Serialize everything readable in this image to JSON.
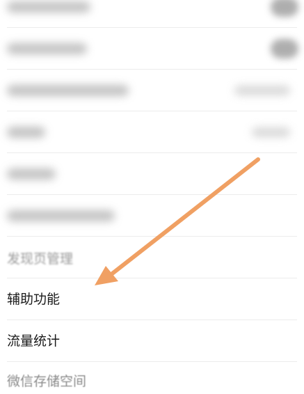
{
  "settings": {
    "items": [
      {
        "label": "发现页管理"
      },
      {
        "label": "辅助功能"
      },
      {
        "label": "流量统计"
      },
      {
        "label": "微信存储空间"
      }
    ]
  },
  "annotation": {
    "arrow_color": "#f0a063"
  }
}
